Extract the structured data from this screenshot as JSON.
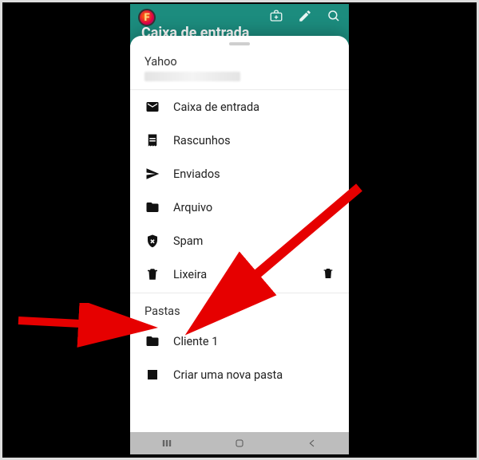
{
  "appbar": {
    "screen_title": "Caixa de entrada"
  },
  "account": {
    "provider": "Yahoo"
  },
  "menu": {
    "inbox": "Caixa de entrada",
    "drafts": "Rascunhos",
    "sent": "Enviados",
    "archive": "Arquivo",
    "spam": "Spam",
    "trash": "Lixeira"
  },
  "folders": {
    "heading": "Pastas",
    "client1": "Cliente 1",
    "create": "Criar uma nova pasta"
  }
}
